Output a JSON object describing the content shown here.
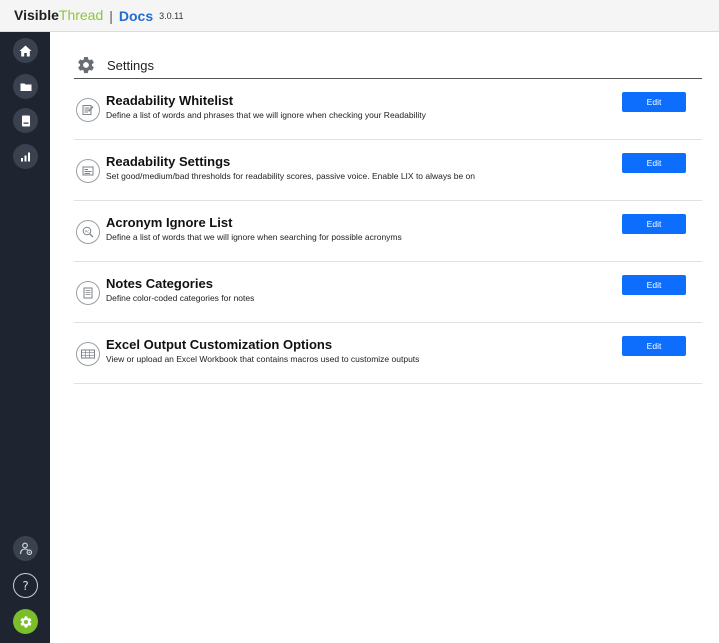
{
  "brand": {
    "visible": "Visible",
    "thread": "Thread",
    "separator": "|",
    "product": "Docs",
    "version": "3.0.11"
  },
  "colors": {
    "sidebar_bg": "#1e2530",
    "accent_green": "#7cbd2a",
    "button_blue": "#0d6efd",
    "brand_blue": "#1f6fd1"
  },
  "sidebar": {
    "top_items": [
      {
        "icon": "home-icon"
      },
      {
        "icon": "folder-icon"
      },
      {
        "icon": "document-icon"
      },
      {
        "icon": "bar-chart-icon"
      }
    ],
    "bottom_items": [
      {
        "icon": "user-settings-icon"
      },
      {
        "icon": "help-icon"
      },
      {
        "icon": "gear-icon",
        "active": true
      }
    ]
  },
  "page": {
    "title": "Settings"
  },
  "settings": [
    {
      "title": "Readability Whitelist",
      "description": "Define a list of words and phrases that we will ignore when checking your Readability",
      "button": "Edit",
      "icon": "whitelist-icon"
    },
    {
      "title": "Readability Settings",
      "description": "Set good/medium/bad thresholds for readability scores, passive voice. Enable LIX to always be on",
      "button": "Edit",
      "icon": "readability-settings-icon"
    },
    {
      "title": "Acronym Ignore List",
      "description": "Define a list of words that we will ignore when searching for possible acronyms",
      "button": "Edit",
      "icon": "acronym-icon"
    },
    {
      "title": "Notes Categories",
      "description": "Define color-coded categories for notes",
      "button": "Edit",
      "icon": "notes-icon"
    },
    {
      "title": "Excel Output Customization Options",
      "description": "View or upload an Excel Workbook that contains macros used to customize outputs",
      "button": "Edit",
      "icon": "spreadsheet-icon"
    }
  ]
}
